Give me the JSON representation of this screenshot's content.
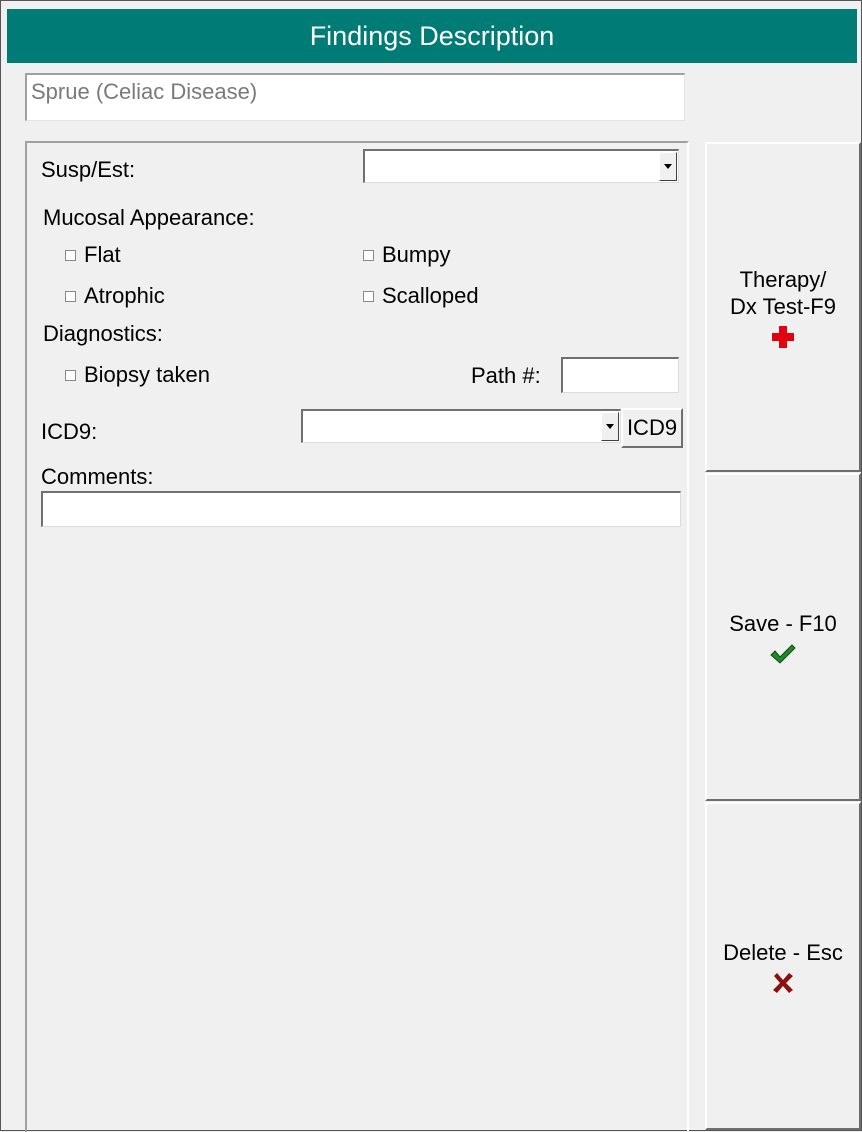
{
  "window": {
    "title": "Findings Description"
  },
  "diagnosis": {
    "value": "Sprue (Celiac Disease)"
  },
  "form": {
    "susp_est_label": "Susp/Est:",
    "susp_est_value": "",
    "mucosal_label": "Mucosal Appearance:",
    "mucosal_options": [
      {
        "label": "Flat",
        "checked": false
      },
      {
        "label": "Bumpy",
        "checked": false
      },
      {
        "label": "Atrophic",
        "checked": false
      },
      {
        "label": "Scalloped",
        "checked": false
      }
    ],
    "diagnostics_label": "Diagnostics:",
    "biopsy_label": "Biopsy taken",
    "biopsy_checked": false,
    "path_label": "Path #:",
    "path_value": "",
    "icd9_label": "ICD9:",
    "icd9_value": "",
    "icd9_button": "ICD9",
    "comments_label": "Comments:",
    "comments_value": ""
  },
  "buttons": {
    "therapy_line1": "Therapy/",
    "therapy_line2": "Dx Test-F9",
    "therapy_icon": "red-cross-icon",
    "save_label": "Save - F10",
    "save_icon": "checkmark-icon",
    "delete_label": "Delete - Esc",
    "delete_icon": "x-mark-icon"
  },
  "colors": {
    "title_bar": "#007b76",
    "cross_icon": "#e3000f",
    "check_icon": "#1f8a2a",
    "x_icon": "#8b1010"
  }
}
